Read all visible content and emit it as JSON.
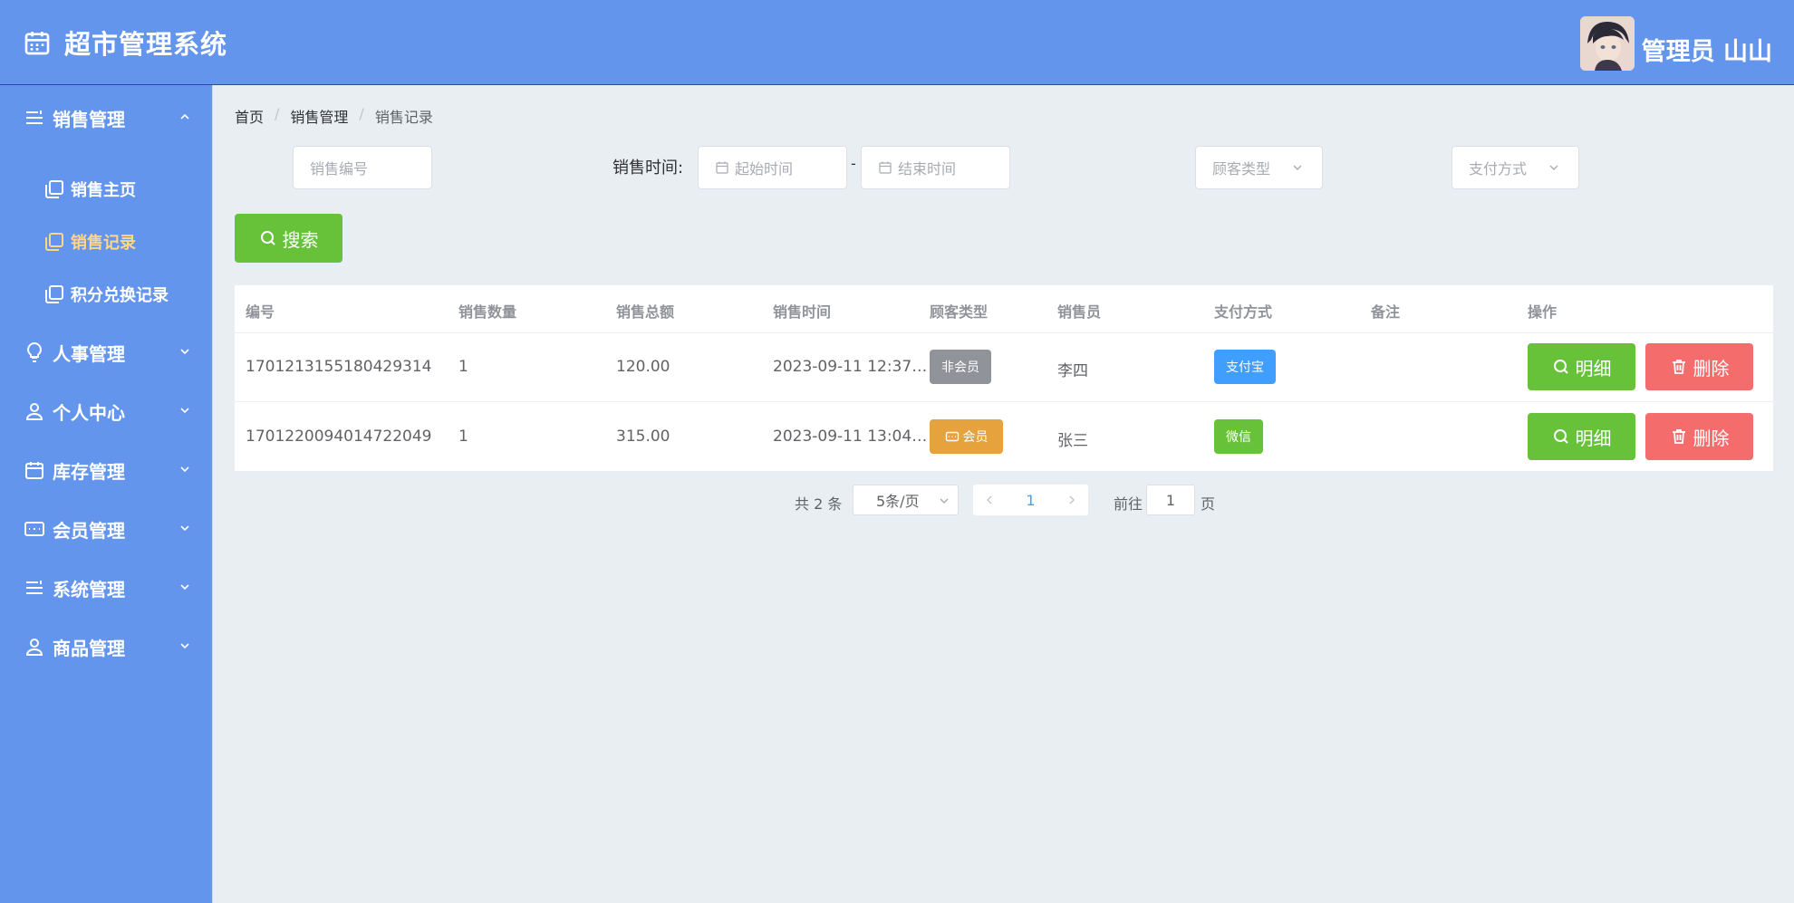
{
  "header": {
    "title": "超市管理系统",
    "user_name": "管理员 山山"
  },
  "sidebar": {
    "sales": {
      "label": "销售管理"
    },
    "sub_items": [
      {
        "label": "销售主页"
      },
      {
        "label": "销售记录"
      },
      {
        "label": "积分兑换记录"
      }
    ],
    "items": [
      {
        "label": "人事管理"
      },
      {
        "label": "个人中心"
      },
      {
        "label": "库存管理"
      },
      {
        "label": "会员管理"
      },
      {
        "label": "系统管理"
      },
      {
        "label": "商品管理"
      }
    ]
  },
  "breadcrumb": [
    "首页",
    "销售管理",
    "销售记录"
  ],
  "filters": {
    "sale_id_placeholder": "销售编号",
    "time_label": "销售时间:",
    "start_placeholder": "起始时间",
    "range_sep": "-",
    "end_placeholder": "结束时间",
    "customer_type_placeholder": "顾客类型",
    "payment_placeholder": "支付方式",
    "search_label": "搜索"
  },
  "table": {
    "columns": [
      "编号",
      "销售数量",
      "销售总额",
      "销售时间",
      "顾客类型",
      "销售员",
      "支付方式",
      "备注",
      "操作"
    ],
    "rows": [
      {
        "id": "1701213155180429314",
        "qty": "1",
        "total": "120.00",
        "time": "2023-09-11 12:37…",
        "customer_type": "非会员",
        "seller": "李四",
        "payment": "支付宝",
        "note": ""
      },
      {
        "id": "1701220094014722049",
        "qty": "1",
        "total": "315.00",
        "time": "2023-09-11 13:04…",
        "customer_type": "会员",
        "seller": "张三",
        "payment": "微信",
        "note": ""
      }
    ],
    "detail_label": "明细",
    "delete_label": "删除"
  },
  "pagination": {
    "total_text": "共 2 条",
    "page_size": "5条/页",
    "current_page": "1",
    "goto_label": "前往",
    "goto_value": "1",
    "page_unit": "页"
  },
  "colors": {
    "brand": "#6495ed",
    "success": "#67c23a",
    "danger": "#f56c6c",
    "warning": "#e6a23c",
    "info_gray": "#909399",
    "alipay_blue": "#409eff",
    "active_menu": "#ffd58a"
  }
}
